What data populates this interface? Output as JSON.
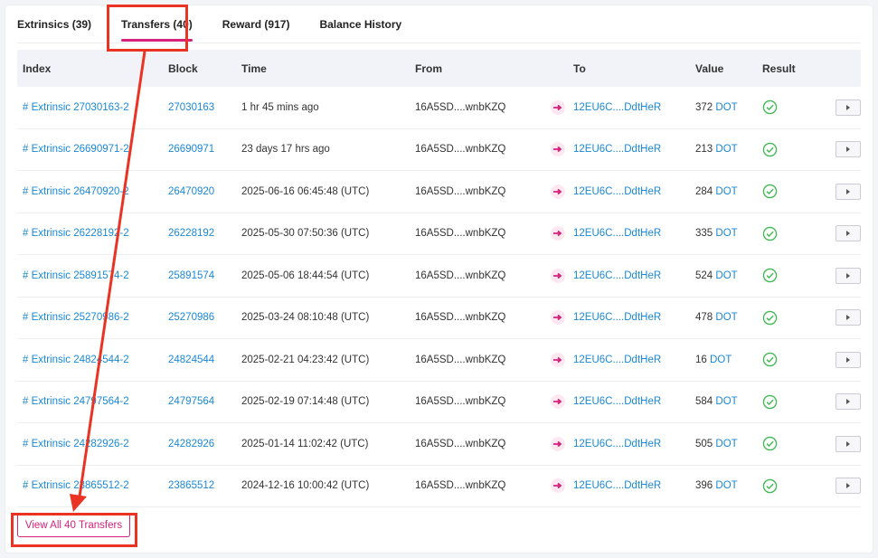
{
  "tabs": [
    {
      "label": "Extrinsics (39)",
      "active": false
    },
    {
      "label": "Transfers (40)",
      "active": true
    },
    {
      "label": "Reward (917)",
      "active": false
    },
    {
      "label": "Balance History",
      "active": false
    }
  ],
  "columns": {
    "index": "Index",
    "block": "Block",
    "time": "Time",
    "from": "From",
    "to": "To",
    "value": "Value",
    "result": "Result"
  },
  "rows": [
    {
      "index": "# Extrinsic 27030163-2",
      "block": "27030163",
      "time": "1 hr 45 mins ago",
      "from": "16A5SD....wnbKZQ",
      "to": "12EU6C....DdtHeR",
      "amount": "372",
      "unit": "DOT"
    },
    {
      "index": "# Extrinsic 26690971-2",
      "block": "26690971",
      "time": "23 days 17 hrs ago",
      "from": "16A5SD....wnbKZQ",
      "to": "12EU6C....DdtHeR",
      "amount": "213",
      "unit": "DOT"
    },
    {
      "index": "# Extrinsic 26470920-2",
      "block": "26470920",
      "time": "2025-06-16 06:45:48 (UTC)",
      "from": "16A5SD....wnbKZQ",
      "to": "12EU6C....DdtHeR",
      "amount": "284",
      "unit": "DOT"
    },
    {
      "index": "# Extrinsic 26228192-2",
      "block": "26228192",
      "time": "2025-05-30 07:50:36 (UTC)",
      "from": "16A5SD....wnbKZQ",
      "to": "12EU6C....DdtHeR",
      "amount": "335",
      "unit": "DOT"
    },
    {
      "index": "# Extrinsic 25891574-2",
      "block": "25891574",
      "time": "2025-05-06 18:44:54 (UTC)",
      "from": "16A5SD....wnbKZQ",
      "to": "12EU6C....DdtHeR",
      "amount": "524",
      "unit": "DOT"
    },
    {
      "index": "# Extrinsic 25270986-2",
      "block": "25270986",
      "time": "2025-03-24 08:10:48 (UTC)",
      "from": "16A5SD....wnbKZQ",
      "to": "12EU6C....DdtHeR",
      "amount": "478",
      "unit": "DOT"
    },
    {
      "index": "# Extrinsic 24824544-2",
      "block": "24824544",
      "time": "2025-02-21 04:23:42 (UTC)",
      "from": "16A5SD....wnbKZQ",
      "to": "12EU6C....DdtHeR",
      "amount": "16",
      "unit": "DOT"
    },
    {
      "index": "# Extrinsic 24797564-2",
      "block": "24797564",
      "time": "2025-02-19 07:14:48 (UTC)",
      "from": "16A5SD....wnbKZQ",
      "to": "12EU6C....DdtHeR",
      "amount": "584",
      "unit": "DOT"
    },
    {
      "index": "# Extrinsic 24282926-2",
      "block": "24282926",
      "time": "2025-01-14 11:02:42 (UTC)",
      "from": "16A5SD....wnbKZQ",
      "to": "12EU6C....DdtHeR",
      "amount": "505",
      "unit": "DOT"
    },
    {
      "index": "# Extrinsic 23865512-2",
      "block": "23865512",
      "time": "2024-12-16 10:00:42 (UTC)",
      "from": "16A5SD....wnbKZQ",
      "to": "12EU6C....DdtHeR",
      "amount": "396",
      "unit": "DOT"
    }
  ],
  "view_all_label": "View All 40 Transfers",
  "colors": {
    "accent": "#d6227a",
    "link": "#1a88d6",
    "success": "#3fb950",
    "annotation": "#ea3323"
  }
}
